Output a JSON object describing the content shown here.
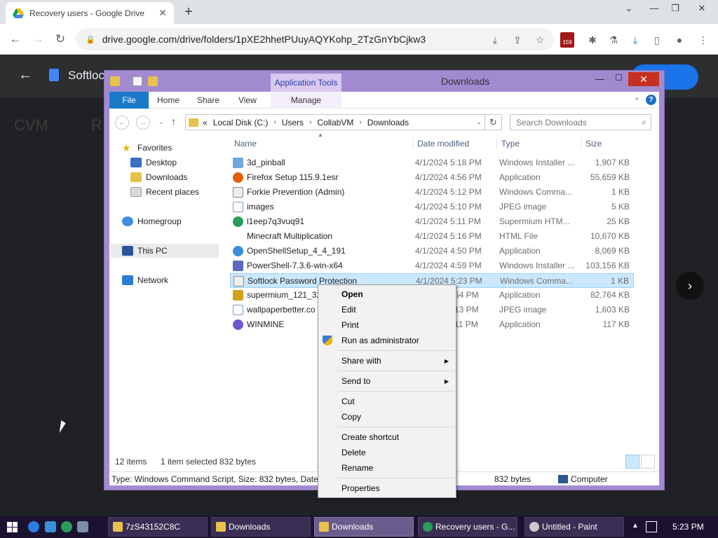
{
  "browser": {
    "tab_title": "Recovery users - Google Drive",
    "tab_close": "✕",
    "new_tab": "+",
    "url": "drive.google.com/drive/folders/1pXE2hhetPUuyAQYKohp_2TzGnYbCjkw3",
    "extension_badge": "159"
  },
  "drive": {
    "file_title": "Softloc",
    "share_label": "e",
    "faded_crumb_1": "CVM",
    "faded_crumb_2": "R"
  },
  "explorer": {
    "title": "Downloads",
    "app_tools": "Application Tools",
    "ribbon_tabs": [
      "File",
      "Home",
      "Share",
      "View",
      "Manage"
    ],
    "address": {
      "prefix": "«",
      "parts": [
        "Local Disk (C:)",
        "Users",
        "CollabVM",
        "Downloads"
      ]
    },
    "search_placeholder": "Search Downloads",
    "nav": {
      "favorites": "Favorites",
      "desktop": "Desktop",
      "downloads": "Downloads",
      "recent": "Recent places",
      "homegroup": "Homegroup",
      "this_pc": "This PC",
      "network": "Network"
    },
    "columns": [
      "Name",
      "Date modified",
      "Type",
      "Size"
    ],
    "files": [
      {
        "name": "3d_pinball",
        "date": "",
        "type": "",
        "size": "",
        "color": "#6fa8dc"
      },
      {
        "name": "Firefox Setup 115.9.1esr",
        "date": "4/1/2024 4:56 PM",
        "type": "Application",
        "size": "55,659 KB",
        "color": "#e66000"
      },
      {
        "name": "Forkie Prevention (Admin)",
        "date": "4/1/2024 5:12 PM",
        "type": "Windows Comma...",
        "size": "1 KB",
        "color": "#888888"
      },
      {
        "name": "images",
        "date": "4/1/2024 5:10 PM",
        "type": "JPEG image",
        "size": "5 KB",
        "color": "#7a9cc6"
      },
      {
        "name": "l1eep7q3vuq91",
        "date": "4/1/2024 5:11 PM",
        "type": "Supermium HTM...",
        "size": "25 KB",
        "color": "#2a9d5c"
      },
      {
        "name": "Minecraft Multiplication",
        "date": "4/1/2024 5:16 PM",
        "type": "HTML File",
        "size": "10,670 KB",
        "color": "#ffffff"
      },
      {
        "name": "OpenShellSetup_4_4_191",
        "date": "4/1/2024 4:50 PM",
        "type": "Application",
        "size": "8,069 KB",
        "color": "#3d8bd9"
      },
      {
        "name": "PowerShell-7.3.6-win-x64",
        "date": "4/1/2024 4:59 PM",
        "type": "Windows Installer ...",
        "size": "103,156 KB",
        "color": "#5c6bc0"
      },
      {
        "name": "Softlock Password Protection",
        "date": "4/1/2024 5:23 PM",
        "type": "Windows Comma...",
        "size": "1 KB",
        "color": "#888888"
      },
      {
        "name": "supermium_121_32",
        "date": "54 PM",
        "type": "Application",
        "size": "82,764 KB",
        "color": "#d4a017"
      },
      {
        "name": "wallpaperbetter.co",
        "date": "13 PM",
        "type": "JPEG image",
        "size": "1,603 KB",
        "color": "#7a9cc6"
      },
      {
        "name": "WINMINE",
        "date": "11 PM",
        "type": "Application",
        "size": "117 KB",
        "color": "#6a5acd"
      }
    ],
    "first_row_date": "4/1/2024 5:18 PM",
    "first_row_type": "Windows Installer ...",
    "first_row_size": "1,907 KB",
    "status": {
      "items": "12 items",
      "selected": "1 item selected",
      "bytes": "832 bytes"
    },
    "details": {
      "info": "Type: Windows Command Script, Size: 832 bytes, Date n",
      "size": "832 bytes",
      "location": "Computer"
    }
  },
  "context_menu": {
    "open": "Open",
    "edit": "Edit",
    "print": "Print",
    "run_admin": "Run as administrator",
    "share_with": "Share with",
    "send_to": "Send to",
    "cut": "Cut",
    "copy": "Copy",
    "create_shortcut": "Create shortcut",
    "delete": "Delete",
    "rename": "Rename",
    "properties": "Properties"
  },
  "taskbar": {
    "buttons": [
      "7zS43152C8C",
      "Downloads",
      "Downloads",
      "Recovery users - G...",
      "Untitled - Paint"
    ],
    "clock": "5:23 PM"
  }
}
